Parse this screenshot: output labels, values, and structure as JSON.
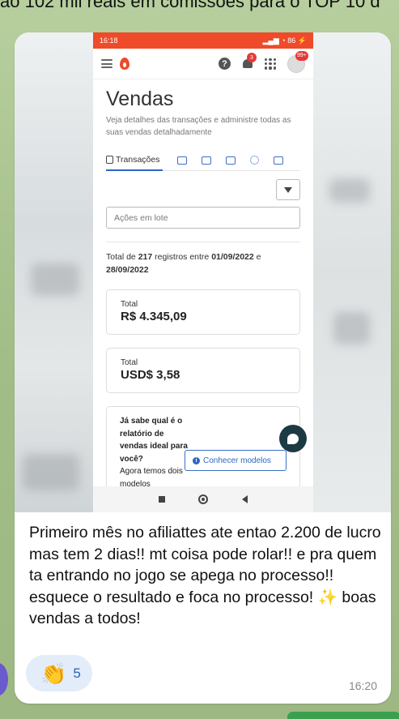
{
  "top_caption": "ao 102 mil reais em comissões para o TOP 10 d",
  "screenshot": {
    "status_bar": {
      "time": "16:18",
      "battery": "86"
    },
    "app_bar": {
      "notifications_badge": "3",
      "avatar_badge": "99+"
    },
    "page": {
      "title": "Vendas",
      "subtitle": "Veja detalhes das transações e administre todas as suas vendas detalhadamente",
      "tab_active": "Transações",
      "batch_actions_placeholder": "Ações em lote",
      "total_prefix": "Total de ",
      "total_count": "217",
      "total_middle": " registros entre ",
      "total_start": "01/09/2022",
      "total_and": " e ",
      "total_end": "28/09/2022",
      "cards": [
        {
          "label": "Total",
          "value": "R$ 4.345,09"
        },
        {
          "label": "Total",
          "value": "USD$ 3,58"
        }
      ],
      "promo": {
        "question": "Já sabe qual é o relatório de vendas ideal para você?",
        "continuation": "Agora temos dois modelos",
        "button": "Conhecer modelos"
      }
    }
  },
  "message": {
    "text": "Primeiro mês no afiliattes ate entao 2.200 de lucro mas tem 2 dias!! mt coisa pode rolar!! e pra quem ta entrando no jogo se apega no processo!! esquece o resultado e foca no processo! ✨ boas vendas a todos!",
    "reaction_emoji": "👏",
    "reaction_count": "5",
    "time": "16:20"
  },
  "colors": {
    "brand": "#ef4a2a",
    "accent": "#2d66c2",
    "reaction_bg": "#e3ecf9"
  }
}
